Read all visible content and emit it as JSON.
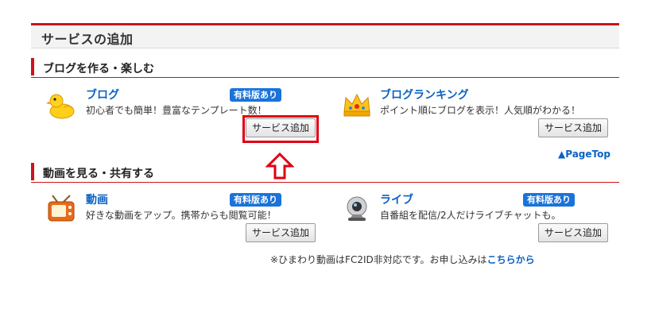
{
  "page": {
    "title": "サービスの追加"
  },
  "sections": [
    {
      "title": "ブログを作る・楽しむ"
    },
    {
      "title": "動画を見る・共有する"
    }
  ],
  "services": {
    "blog": {
      "name": "ブログ",
      "desc": "初心者でも簡単！豊富なテンプレート数！",
      "badge": "有料版あり",
      "button": "サービス追加",
      "icon": "duck-icon"
    },
    "ranking": {
      "name": "ブログランキング",
      "desc": "ポイント順にブログを表示！人気順がわかる！",
      "button": "サービス追加",
      "icon": "crown-icon"
    },
    "video": {
      "name": "動画",
      "desc": "好きな動画をアップ。携帯からも閲覧可能！",
      "badge": "有料版あり",
      "button": "サービス追加",
      "icon": "tv-icon"
    },
    "live": {
      "name": "ライブ",
      "desc": "自番組を配信/2人だけライブチャットも。",
      "badge": "有料版あり",
      "button": "サービス追加",
      "icon": "webcam-icon"
    }
  },
  "pagetop": "▲PageTop",
  "note": {
    "text": "※ひまわり動画はFC2ID非対応です。お申し込みは",
    "link": "こちらから"
  },
  "colors": {
    "accent": "#d0121b",
    "link": "#0b62c4",
    "badge": "#1a73d9",
    "annotation": "#e00010"
  }
}
